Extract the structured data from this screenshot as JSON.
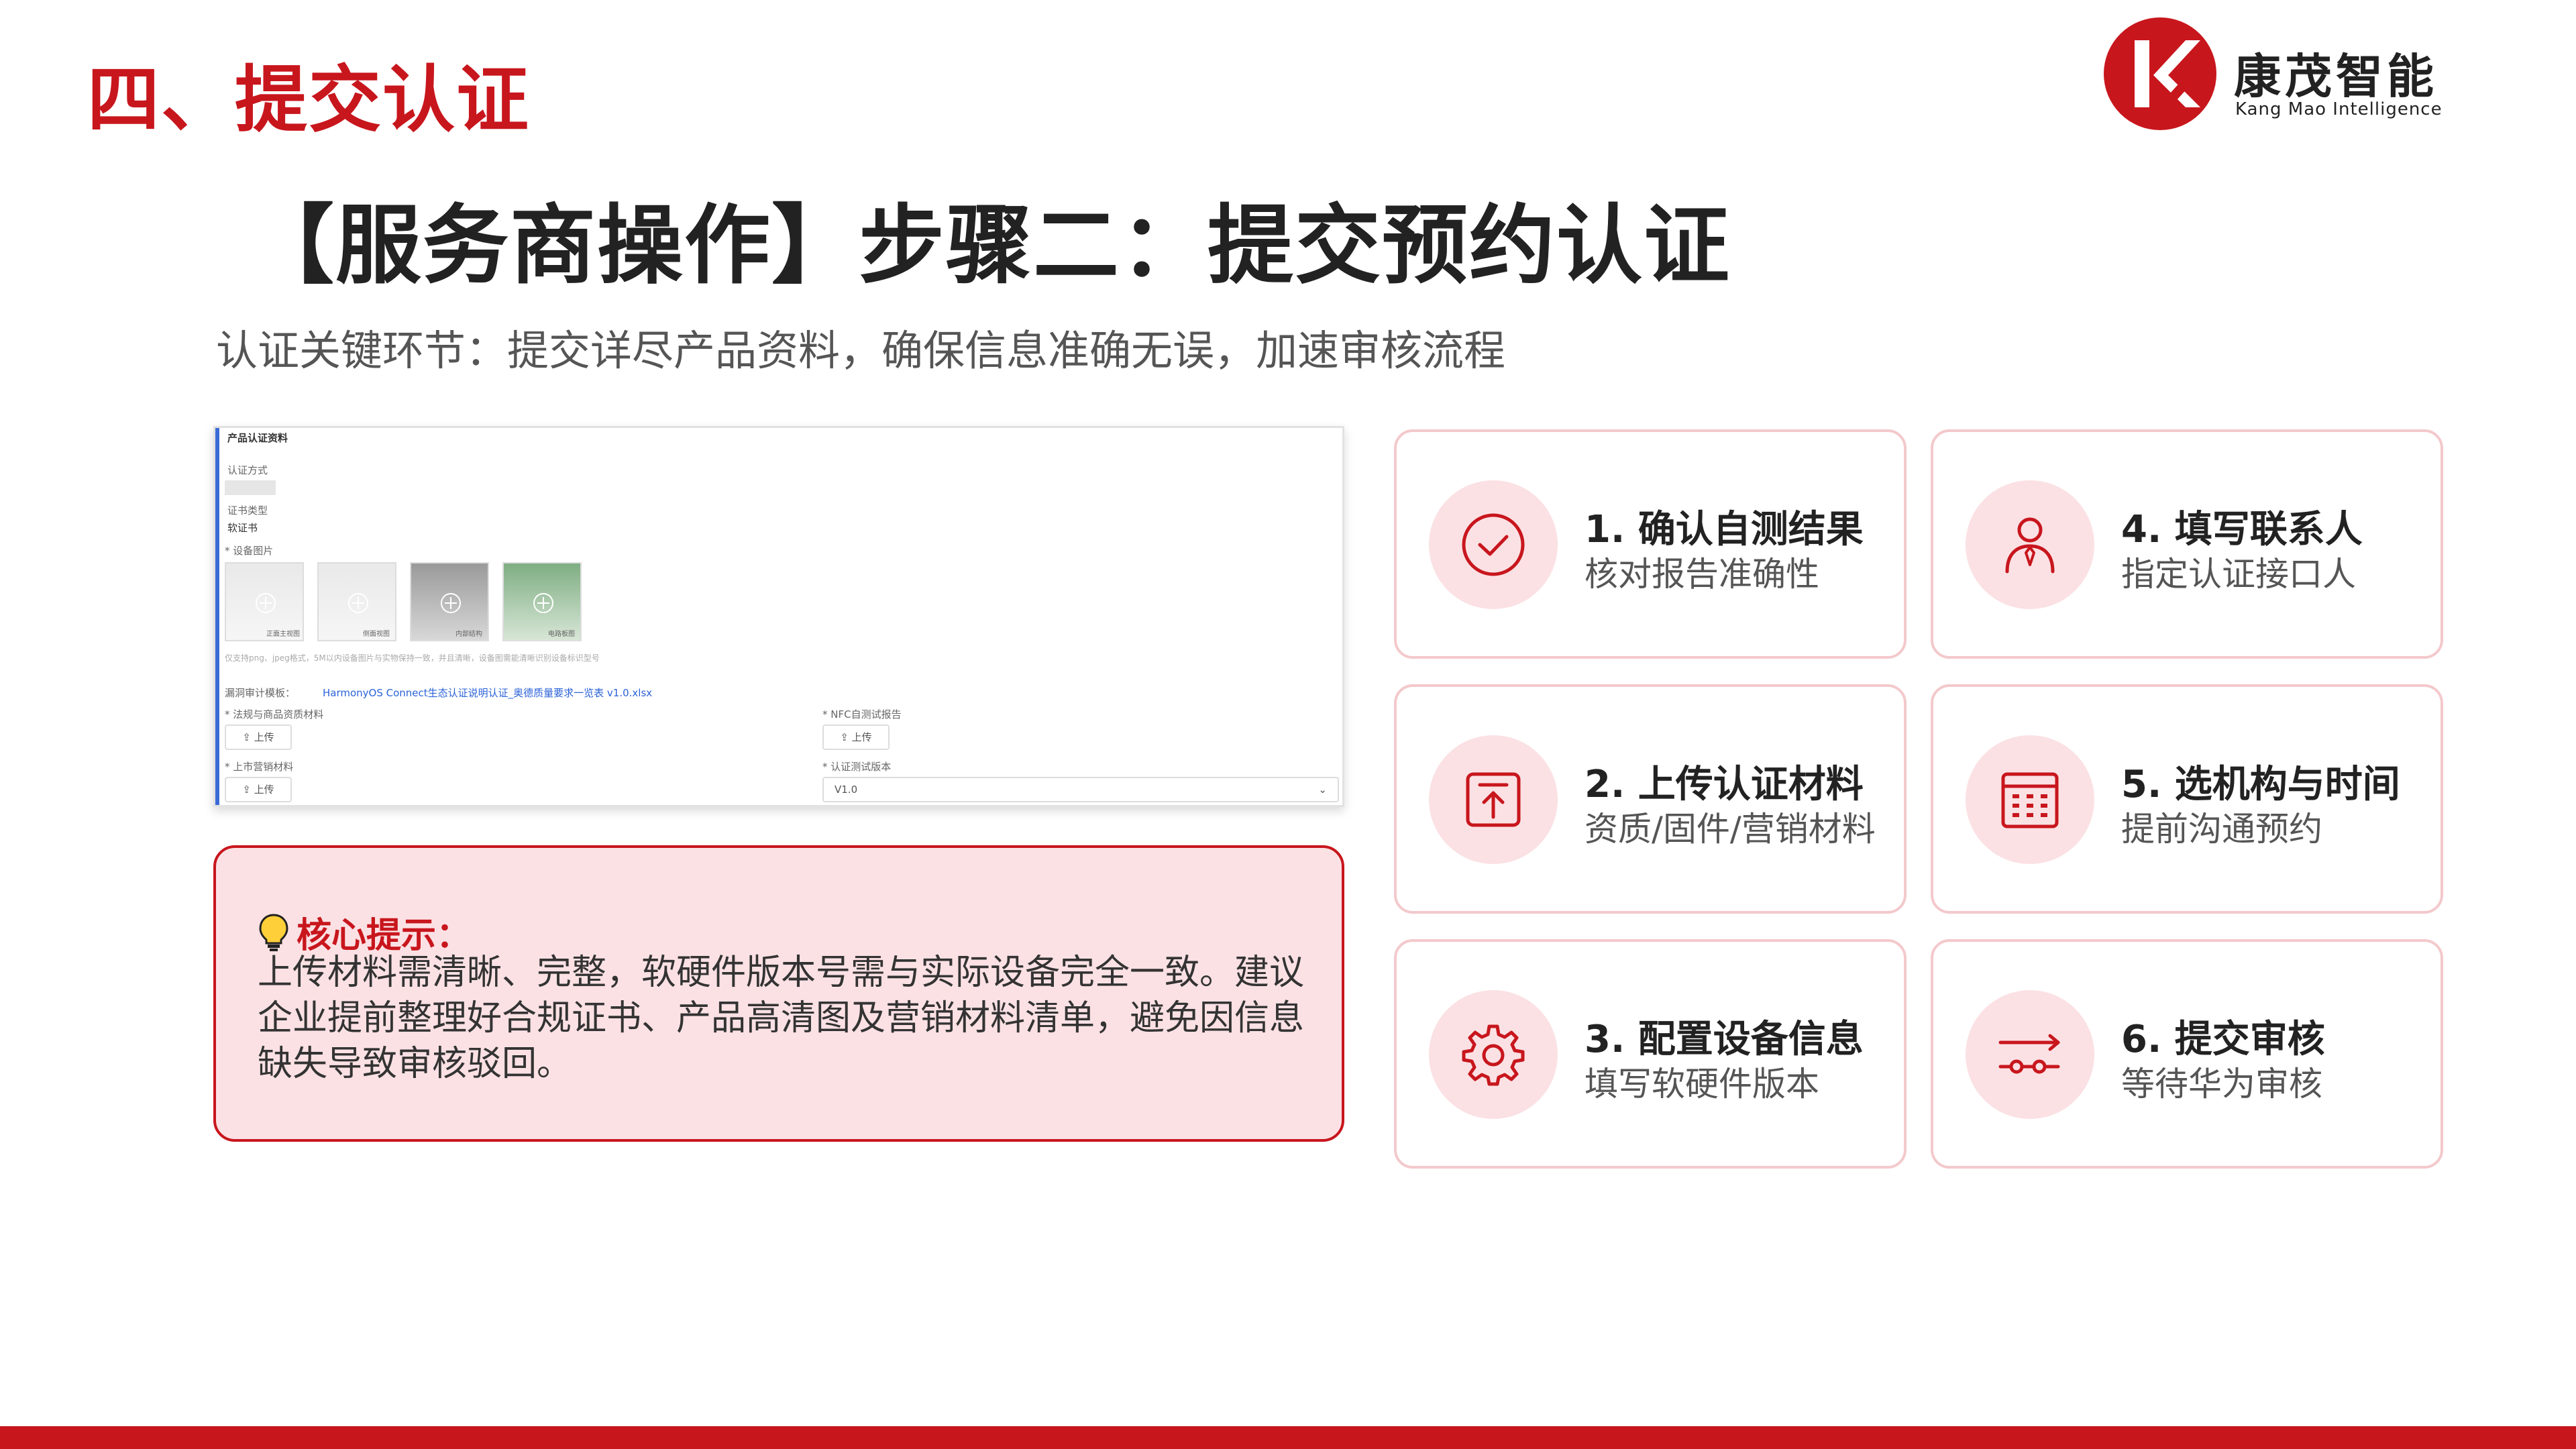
{
  "header": {
    "section_title": "四、提交认证",
    "logo": {
      "name_cn": "康茂智能",
      "name_en": "Kang Mao Intelligence",
      "brand_color": "#c8161d"
    }
  },
  "main_title": "【服务商操作】步骤二：提交预约认证",
  "subtitle": "认证关键环节：提交详尽产品资料，确保信息准确无误，加速审核流程",
  "screenshot": {
    "heading": "产品认证资料",
    "auth_method_label": "认证方式",
    "cert_type_label": "证书类型",
    "cert_type_value": "软证书",
    "device_images_label": "* 设备图片",
    "thumb_captions": [
      "正面主视图",
      "侧面视图",
      "内部结构",
      "电路板图"
    ],
    "upload_hint": "仅支持png、jpeg格式，5M以内设备图片与实物保持一致，并且清晰，设备图需能清晰识别设备标识型号",
    "template_label": "漏洞审计模板：",
    "template_link": "HarmonyOS Connect生态认证说明认证_奥德质量要求一览表 v1.0.xlsx",
    "left_field_1": "* 法规与商品资质材料",
    "right_field_1": "* NFC自测试报告",
    "left_field_2": "* 上市营销材料",
    "right_field_2": "* 认证测试版本",
    "upload_button": "上传",
    "version_value": "V1.0"
  },
  "tip": {
    "icon": "lightbulb-icon",
    "title": "核心提示：",
    "body": "上传材料需清晰、完整，软硬件版本号需与实际设备完全一致。建议企业提前整理好合规证书、产品高清图及营销材料清单，避免因信息缺失导致审核驳回。"
  },
  "steps": [
    {
      "title": "1. 确认自测结果",
      "desc": "核对报告准确性",
      "icon": "check-circle-icon"
    },
    {
      "title": "2. 上传认证材料",
      "desc": "资质/固件/营销材料",
      "icon": "upload-icon"
    },
    {
      "title": "3. 配置设备信息",
      "desc": "填写软硬件版本",
      "icon": "gear-icon"
    },
    {
      "title": "4. 填写联系人",
      "desc": "指定认证接口人",
      "icon": "person-icon"
    },
    {
      "title": "5. 选机构与时间",
      "desc": "提前沟通预约",
      "icon": "calendar-icon"
    },
    {
      "title": "6. 提交审核",
      "desc": "等待华为审核",
      "icon": "flow-arrow-icon"
    }
  ],
  "colors": {
    "accent": "#c8161d",
    "card_border": "#f3c9cc",
    "tip_bg": "#fbe1e4"
  }
}
